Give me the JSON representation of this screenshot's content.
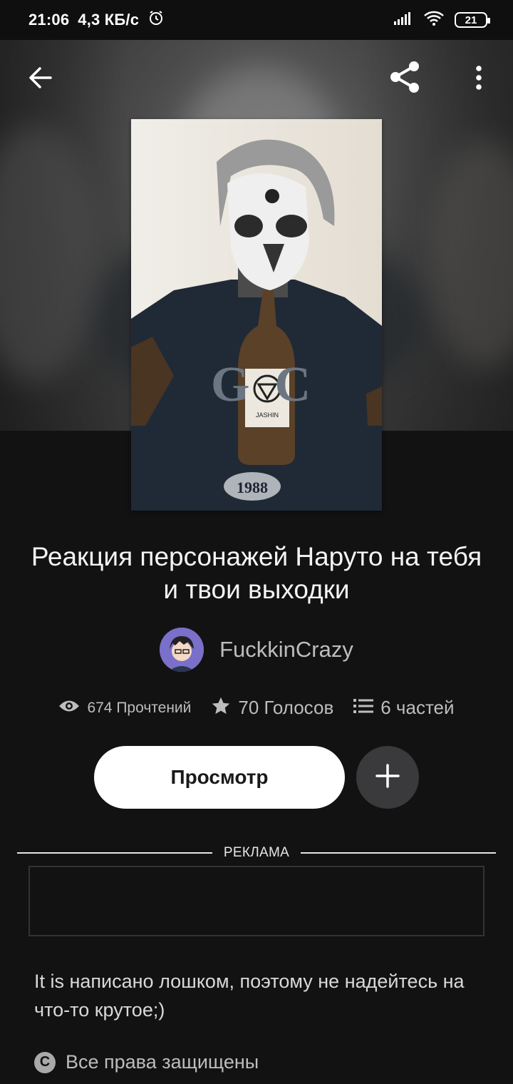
{
  "status_bar": {
    "time": "21:06",
    "speed": "4,3 КБ/с",
    "battery": "21"
  },
  "book": {
    "title": "Реакция персонажей Наруто на тебя и твои выходки",
    "author": "FuckkinCrazy",
    "reads": "674 Прочтений",
    "votes": "70 Голосов",
    "parts": "6 частей",
    "read_label": "Просмотр",
    "ad_label": "РЕКЛАМА",
    "description": "It is написано лошком, поэтому не надейтесь на что-то крутое;)",
    "rights": "Все права защищены",
    "cover_texts": {
      "letters": "G  C",
      "label": "JASHIN",
      "year": "1988"
    }
  },
  "icons": {
    "back": "arrow-left-icon",
    "share": "share-icon",
    "more": "more-vertical-icon",
    "eye": "eye-icon",
    "star": "star-icon",
    "list": "list-icon",
    "plus": "plus-icon",
    "copyright": "copyright-icon"
  },
  "colors": {
    "background": "#121212",
    "button_primary": "#ffffff",
    "button_secondary": "#3a3a3c",
    "muted_text": "#bdbdbd"
  }
}
